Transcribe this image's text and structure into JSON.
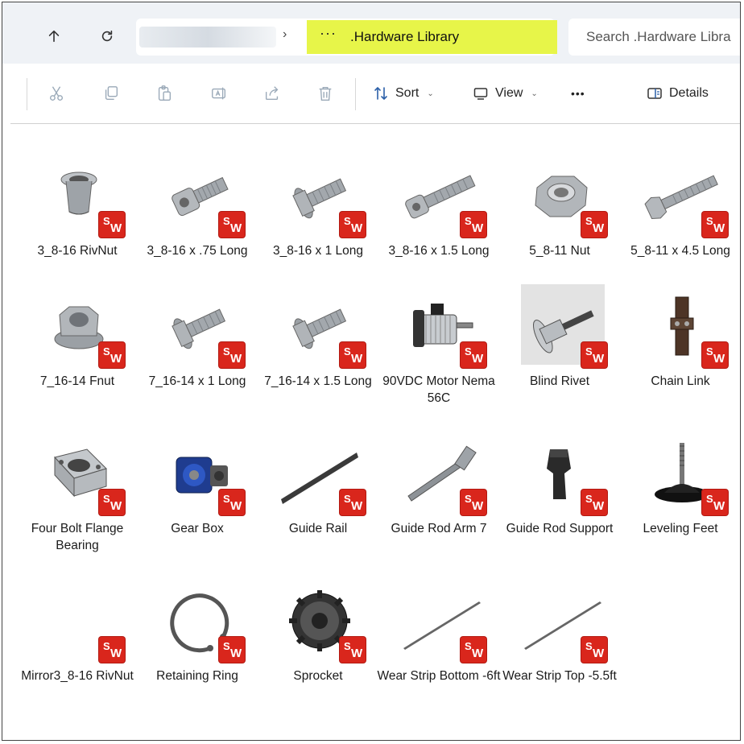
{
  "address": {
    "more": "···",
    "current_folder": ".Hardware Library",
    "search_placeholder": "Search .Hardware Libra"
  },
  "toolbar": {
    "sort_label": "Sort",
    "view_label": "View",
    "more": "•••",
    "details_label": "Details"
  },
  "badge": {
    "s": "S",
    "w": "W"
  },
  "files": [
    {
      "name": "3_8-16 RivNut",
      "icon": "rivnut-icon"
    },
    {
      "name": "3_8-16 x .75 Long",
      "icon": "socket-bolt-icon"
    },
    {
      "name": "3_8-16 x 1 Long",
      "icon": "flange-bolt-icon"
    },
    {
      "name": "3_8-16 x 1.5 Long",
      "icon": "socket-bolt-long-icon"
    },
    {
      "name": "5_8-11 Nut",
      "icon": "hex-nut-icon"
    },
    {
      "name": "5_8-11 x 4.5 Long",
      "icon": "hex-bolt-long-icon"
    },
    {
      "name": "7_16-14 Fnut",
      "icon": "flange-nut-icon"
    },
    {
      "name": "7_16-14 x 1 Long",
      "icon": "flange-bolt-icon"
    },
    {
      "name": "7_16-14 x 1.5 Long",
      "icon": "flange-bolt-icon"
    },
    {
      "name": "90VDC Motor Nema 56C",
      "icon": "motor-icon"
    },
    {
      "name": "Blind Rivet",
      "icon": "blind-rivet-icon"
    },
    {
      "name": "Chain Link",
      "icon": "chain-link-icon"
    },
    {
      "name": "Four Bolt Flange Bearing",
      "icon": "flange-bearing-icon"
    },
    {
      "name": "Gear Box",
      "icon": "gear-box-icon"
    },
    {
      "name": "Guide Rail",
      "icon": "guide-rail-icon"
    },
    {
      "name": "Guide Rod Arm 7",
      "icon": "guide-rod-arm-icon"
    },
    {
      "name": "Guide Rod Support",
      "icon": "guide-rod-support-icon"
    },
    {
      "name": "Leveling Feet",
      "icon": "leveling-foot-icon"
    },
    {
      "name": "Mirror3_8-16 RivNut",
      "icon": "blank-part-icon"
    },
    {
      "name": "Retaining Ring",
      "icon": "retaining-ring-icon"
    },
    {
      "name": "Sprocket",
      "icon": "sprocket-icon"
    },
    {
      "name": "Wear Strip Bottom -6ft",
      "icon": "wear-strip-icon"
    },
    {
      "name": "Wear Strip Top -5.5ft",
      "icon": "wear-strip-icon"
    }
  ]
}
